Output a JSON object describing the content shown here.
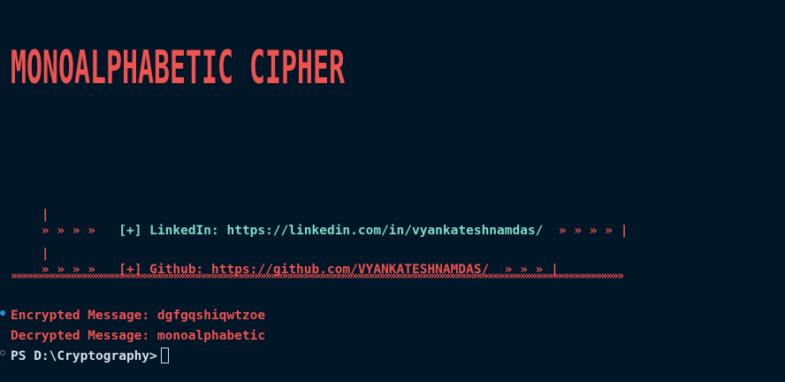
{
  "banner": {
    "title": "MONOALPHABETIC CIPHER",
    "color": "#ef5350"
  },
  "links": [
    {
      "pipe_left": "|",
      "arrows_left": "» » » »",
      "tag": "[+]",
      "label": "LinkedIn:",
      "url": "https://linkedin.com/in/vyankateshnamdas/",
      "arrows_right": "» » » »",
      "pipe_right": "|"
    },
    {
      "pipe_left": "|",
      "arrows_left": "» » » »",
      "tag": "[+]",
      "label": "Github:",
      "url": "https://github.com/VYANKATESHNAMDAS/",
      "arrows_right": "» » »",
      "pipe_right": "|"
    }
  ],
  "separator": "»»»»»»»»»»»»»»»»»»»»»»»»»»»»»»»»»»»»»»»»»»»»»»»»»»»»»»»»»»»»»»»»»»»»»»»»»»»»»»»»»»»»»»»»»»»»»»»»»»»»»»»»»»»»»»»»»",
  "output": {
    "encrypted_label": "Encrypted Message:",
    "encrypted_value": "dgfgqshiqwtzoe",
    "decrypted_label": "Decrypted Message:",
    "decrypted_value": "monoalphabetic"
  },
  "prompt": {
    "text": "PS D:\\Cryptography>"
  },
  "colors": {
    "background": "#011627",
    "accent_red": "#ef5350",
    "teal": "#7fdbca",
    "text": "#d6deeb"
  }
}
